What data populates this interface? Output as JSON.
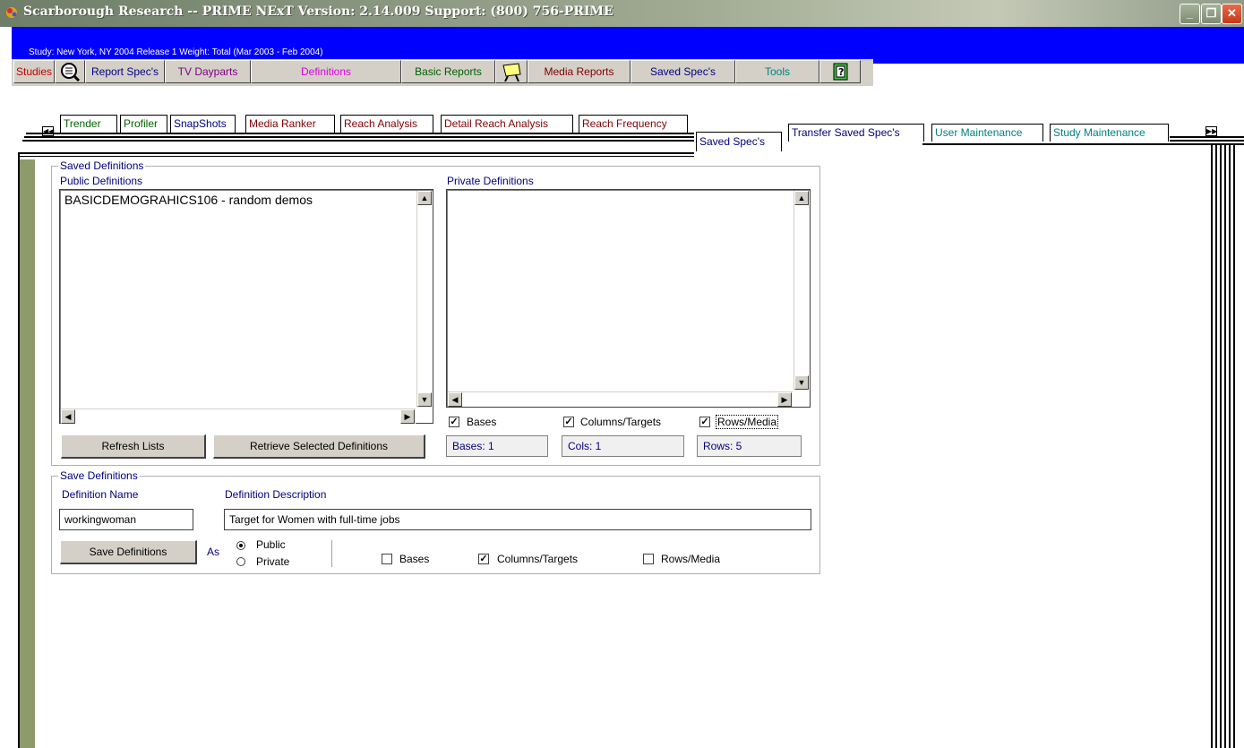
{
  "window": {
    "title": "Scarborough Research -- PRIME NExT  Version: 2.14.009   Support: (800) 756-PRIME",
    "minimize": "_",
    "restore": "❐",
    "close": "✕"
  },
  "study_info": "Study: New York, NY 2004 Release 1    Weight: Total (Mar 2003 - Feb 2004)",
  "menu": {
    "studies": "Studies",
    "report_specs": "Report Spec's",
    "tv_dayparts": "TV Dayparts",
    "definitions": "Definitions",
    "basic_reports": "Basic Reports",
    "media_reports": "Media Reports",
    "saved_specs": "Saved Spec's",
    "tools": "Tools"
  },
  "colors": {
    "studies": "#c00000",
    "report_specs": "#000080",
    "tv_dayparts": "#800080",
    "definitions": "#e000e0",
    "basic_reports": "#006000",
    "media_reports": "#800000",
    "saved_specs": "#000080",
    "tools": "#008080"
  },
  "tabs_left": [
    "Trender",
    "Profiler",
    "SnapShots",
    "Media Ranker",
    "Reach Analysis",
    "Detail Reach Analysis",
    "Reach Frequency"
  ],
  "tabs_right": [
    "Saved Spec's",
    "Transfer Saved Spec's",
    "User Maintenance",
    "Study Maintenance"
  ],
  "saved_definitions": {
    "group_title": "Saved Definitions",
    "public_label": "Public Definitions",
    "private_label": "Private Definitions",
    "public_items": [
      "BASICDEMOGRAHICS106 - random demos"
    ],
    "private_items": [],
    "refresh_button": "Refresh Lists",
    "retrieve_button": "Retrieve Selected Definitions",
    "bases_label": "Bases",
    "bases_checked": true,
    "columns_label": "Columns/Targets",
    "columns_checked": true,
    "rows_label": "Rows/Media",
    "rows_checked": true,
    "bases_count": "Bases: 1",
    "cols_count": "Cols: 1",
    "rows_count": "Rows: 5"
  },
  "save_definitions": {
    "group_title": "Save Definitions",
    "name_label": "Definition Name",
    "desc_label": "Definition Description",
    "name_value": "workingwoman",
    "desc_value": "Target for Women with full-time jobs",
    "save_button": "Save Definitions",
    "as_label": "As",
    "public_option": "Public",
    "private_option": "Private",
    "selected_option": "Public",
    "bases_label": "Bases",
    "bases_checked": false,
    "columns_label": "Columns/Targets",
    "columns_checked": true,
    "rows_label": "Rows/Media",
    "rows_checked": false
  }
}
